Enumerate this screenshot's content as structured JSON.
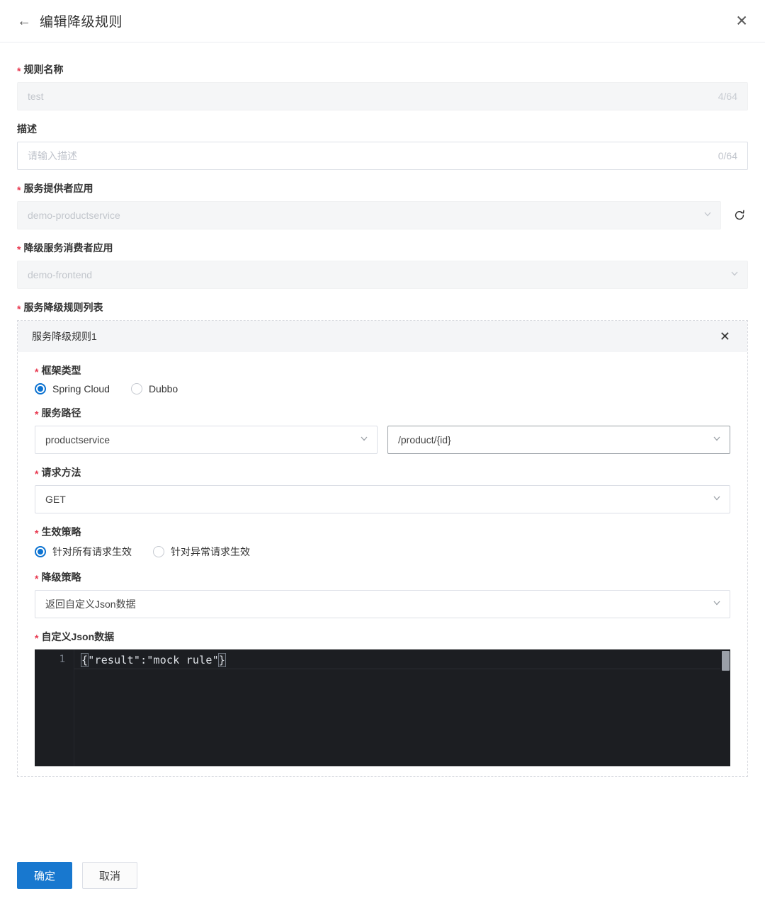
{
  "header": {
    "title": "编辑降级规则",
    "back_icon": "arrow-left-icon",
    "close_icon": "close-icon"
  },
  "form": {
    "rule_name": {
      "label": "规则名称",
      "required": true,
      "value": "test",
      "counter": "4/64",
      "disabled": true
    },
    "description": {
      "label": "描述",
      "required": false,
      "placeholder": "请输入描述",
      "value": "",
      "counter": "0/64",
      "disabled": false
    },
    "provider_app": {
      "label": "服务提供者应用",
      "required": true,
      "value": "demo-productservice",
      "disabled": true,
      "refresh_icon": "refresh-icon",
      "chevron_icon": "chevron-down-icon"
    },
    "consumer_app": {
      "label": "降级服务消费者应用",
      "required": true,
      "value": "demo-frontend",
      "disabled": true,
      "chevron_icon": "chevron-down-icon"
    },
    "rule_list": {
      "label": "服务降级规则列表",
      "required": true
    }
  },
  "rule_card": {
    "title": "服务降级规则1",
    "remove_icon": "close-icon",
    "framework_type": {
      "label": "框架类型",
      "required": true,
      "options": [
        "Spring Cloud",
        "Dubbo"
      ],
      "selected": "Spring Cloud"
    },
    "service_path": {
      "label": "服务路径",
      "required": true,
      "service_value": "productservice",
      "path_value": "/product/{id}",
      "chevron_icon": "chevron-down-icon"
    },
    "request_method": {
      "label": "请求方法",
      "required": true,
      "value": "GET",
      "chevron_icon": "chevron-down-icon"
    },
    "effect_strategy": {
      "label": "生效策略",
      "required": true,
      "options": [
        "针对所有请求生效",
        "针对异常请求生效"
      ],
      "selected": "针对所有请求生效"
    },
    "degrade_strategy": {
      "label": "降级策略",
      "required": true,
      "value": "返回自定义Json数据",
      "chevron_icon": "chevron-down-icon"
    },
    "custom_json": {
      "label": "自定义Json数据",
      "required": true,
      "line_number": "1",
      "code_open_brace": "{",
      "code_body": "\"result\":\"mock rule\"",
      "code_close_brace": "}"
    }
  },
  "footer": {
    "confirm_label": "确定",
    "cancel_label": "取消"
  },
  "colors": {
    "primary": "#1878cf",
    "radio_accent": "#0b72d1",
    "required_asterisk": "#e8384f",
    "editor_background": "#1c1e22"
  }
}
